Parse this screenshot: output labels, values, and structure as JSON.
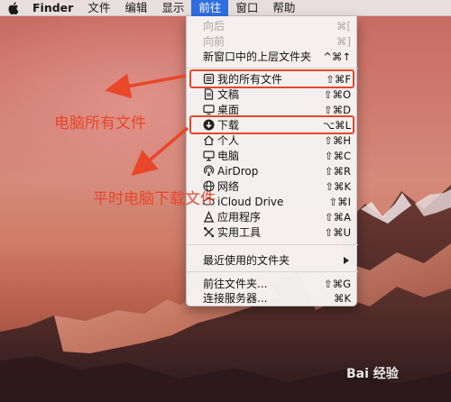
{
  "menubar": {
    "apple_icon": "apple-logo",
    "items": [
      "Finder",
      "文件",
      "编辑",
      "显示",
      "前往",
      "窗口",
      "帮助"
    ],
    "active_index": 4
  },
  "go_menu": {
    "items": [
      {
        "label": "向后",
        "shortcut": "⌘[",
        "disabled": true
      },
      {
        "label": "向前",
        "shortcut": "⌘]",
        "disabled": true
      },
      {
        "label": "新窗口中的上层文件夹",
        "shortcut": "^⌘↑"
      },
      {
        "label": "我的所有文件",
        "shortcut": "⇧⌘F",
        "icon": "all-files-icon"
      },
      {
        "label": "文稿",
        "shortcut": "⇧⌘O",
        "icon": "documents-icon"
      },
      {
        "label": "桌面",
        "shortcut": "⇧⌘D",
        "icon": "desktop-icon"
      },
      {
        "label": "下载",
        "shortcut": "⌥⌘L",
        "icon": "downloads-icon"
      },
      {
        "label": "个人",
        "shortcut": "⇧⌘H",
        "icon": "home-icon"
      },
      {
        "label": "电脑",
        "shortcut": "⇧⌘C",
        "icon": "computer-icon"
      },
      {
        "label": "AirDrop",
        "shortcut": "⇧⌘R",
        "icon": "airdrop-icon"
      },
      {
        "label": "网络",
        "shortcut": "⇧⌘K",
        "icon": "network-icon"
      },
      {
        "label": "iCloud Drive",
        "shortcut": "⇧⌘I",
        "icon": "icloud-icon"
      },
      {
        "label": "应用程序",
        "shortcut": "⇧⌘A",
        "icon": "applications-icon"
      },
      {
        "label": "实用工具",
        "shortcut": "⇧⌘U",
        "icon": "utilities-icon"
      },
      {
        "label": "最近使用的文件夹",
        "submenu": true
      },
      {
        "label": "前往文件夹...",
        "shortcut": "⇧⌘G"
      },
      {
        "label": "连接服务器...",
        "shortcut": "⌘K"
      }
    ]
  },
  "annotations": {
    "label_all_files": "电脑所有文件",
    "label_downloads": "平时电脑下载文件",
    "highlight_color": "#e9462a"
  },
  "watermark": "Bai 经验"
}
